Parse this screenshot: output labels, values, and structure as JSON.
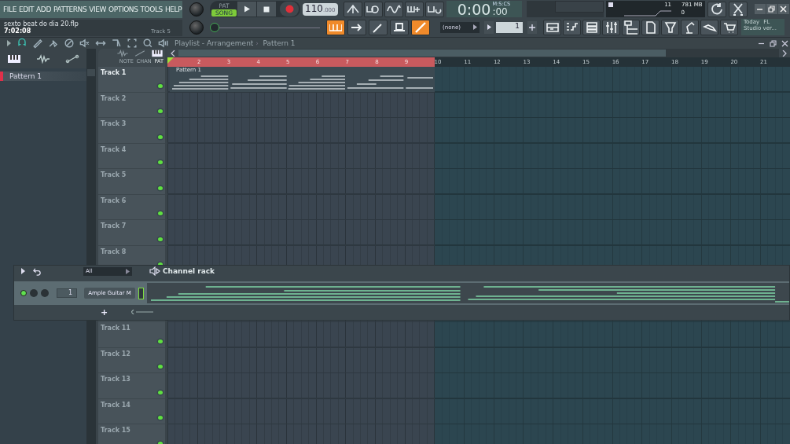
{
  "menu": [
    "FILE",
    "EDIT",
    "ADD",
    "PATTERNS",
    "VIEW",
    "OPTIONS",
    "TOOLS",
    "HELP"
  ],
  "project": {
    "filename": "sexto beat do dia 20.flp",
    "time": "7:02:08",
    "track": "Track 5"
  },
  "transport": {
    "modes": [
      {
        "label": "PAT",
        "selected": false
      },
      {
        "label": "SONG",
        "selected": true
      }
    ],
    "tempo": "110",
    "tempo_fraction": ".000"
  },
  "time": {
    "main": "0:00",
    "sub": ":00",
    "label": "M:S:CS"
  },
  "pitch": {
    "level": 0
  },
  "monitor": {
    "cpu": "11",
    "memory": "781 MB",
    "polyphony": "0"
  },
  "pattern_selector": {
    "value": "(none)"
  },
  "step": {
    "value": "1"
  },
  "news": {
    "line1": "Today",
    "line1b": "FL",
    "line2": "Studio ver..."
  },
  "playlist": {
    "title": "Playlist - Arrangement",
    "separator": "›",
    "pattern": "Pattern 1",
    "picker": [
      {
        "label": "Pattern 1",
        "selected": true
      }
    ],
    "view_tabs": [
      {
        "label": "NOTE",
        "selected": false
      },
      {
        "label": "CHAN",
        "selected": false
      },
      {
        "label": "PAT",
        "selected": true
      }
    ],
    "bars": [
      "2",
      "3",
      "4",
      "5",
      "6",
      "7",
      "8",
      "9",
      "10",
      "11",
      "12",
      "13",
      "14",
      "15",
      "16",
      "17",
      "18",
      "19",
      "20",
      "21"
    ],
    "clip": {
      "label": "Pattern 1"
    },
    "tracks": [
      {
        "name": "Track 1",
        "used": true
      },
      {
        "name": "Track 2",
        "used": false
      },
      {
        "name": "Track 3",
        "used": false
      },
      {
        "name": "Track 4",
        "used": false
      },
      {
        "name": "Track 5",
        "used": false
      },
      {
        "name": "Track 6",
        "used": false
      },
      {
        "name": "Track 7",
        "used": false
      },
      {
        "name": "Track 8",
        "used": false
      }
    ],
    "tracks_below": [
      {
        "name": "Track 11",
        "used": false
      },
      {
        "name": "Track 12",
        "used": false
      },
      {
        "name": "Track 13",
        "used": false
      },
      {
        "name": "Track 14",
        "used": false
      },
      {
        "name": "Track 15",
        "used": false
      }
    ]
  },
  "channel_rack": {
    "title": "Channel rack",
    "filter": "All",
    "add": "+",
    "channels": [
      {
        "name": "Ample Guitar M",
        "number": "1",
        "on": true,
        "selected": true
      }
    ]
  }
}
